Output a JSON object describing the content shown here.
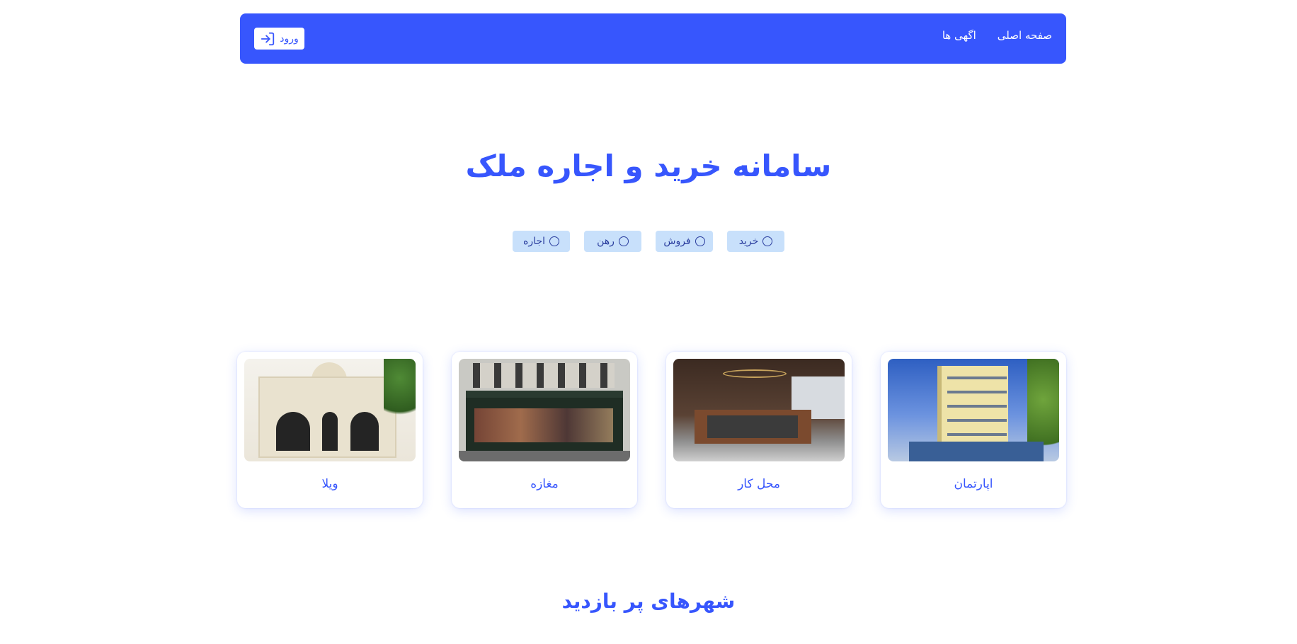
{
  "nav": {
    "links": [
      "صفحه اصلی",
      "اگهی ها"
    ],
    "login_label": "ورود"
  },
  "hero": {
    "title": "سامانه خرید و اجاره ملک"
  },
  "filters": [
    "خرید",
    "فروش",
    "رهن",
    "اجاره"
  ],
  "categories": [
    {
      "label": "اپارتمان"
    },
    {
      "label": "محل کار"
    },
    {
      "label": "مغازه"
    },
    {
      "label": "ویلا"
    }
  ],
  "section": {
    "popular_cities_title": "شهرهای پر بازدید"
  },
  "colors": {
    "primary": "#3756fd",
    "chip_bg": "#c8e0fb",
    "chip_text": "#2a3d9e"
  }
}
